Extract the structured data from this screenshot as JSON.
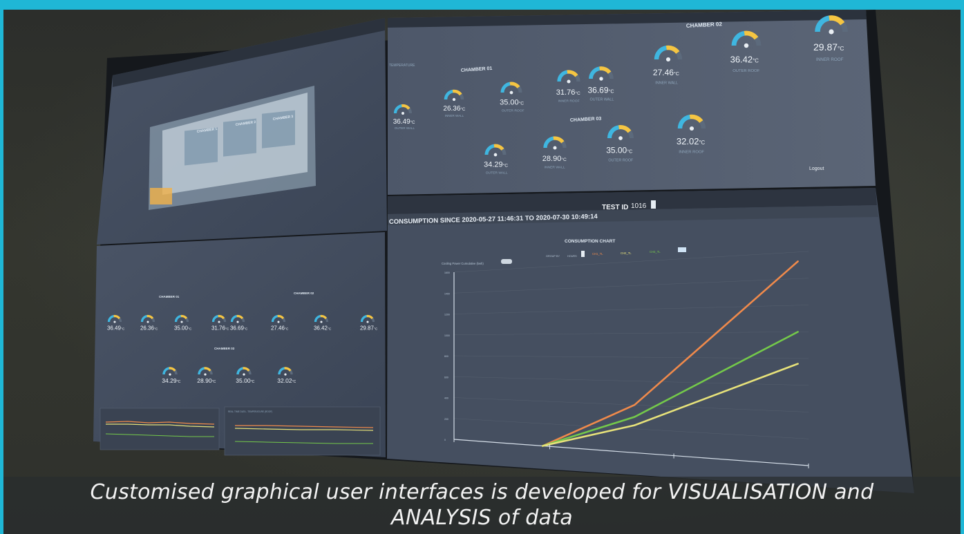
{
  "screens": {
    "top_left": {
      "chambers": [
        "CHAMBER 1",
        "CHAMBER 2",
        "CHAMBER 3"
      ]
    },
    "top_right": {
      "section_label": "TEMPERATURE",
      "chamber_01": {
        "title": "CHAMBER 01",
        "gauges": [
          {
            "value": "36.49",
            "unit": "°C",
            "label": "OUTER WALL"
          },
          {
            "value": "26.36",
            "unit": "°C",
            "label": "INNER WALL"
          },
          {
            "value": "35.00",
            "unit": "°C",
            "label": "OUTER ROOF"
          },
          {
            "value": "31.76",
            "unit": "°C",
            "label": "INNER ROOF"
          }
        ]
      },
      "chamber_02": {
        "title": "CHAMBER 02",
        "gauges": [
          {
            "value": "36.69",
            "unit": "°C",
            "label": "OUTER WALL"
          },
          {
            "value": "27.46",
            "unit": "°C",
            "label": "INNER WALL"
          },
          {
            "value": "36.42",
            "unit": "°C",
            "label": "OUTER ROOF"
          },
          {
            "value": "29.87",
            "unit": "°C",
            "label": "INNER ROOF"
          }
        ]
      },
      "chamber_03": {
        "title": "CHAMBER 03",
        "gauges": [
          {
            "value": "34.29",
            "unit": "°C",
            "label": "OUTER WALL"
          },
          {
            "value": "28.90",
            "unit": "°C",
            "label": "INNER WALL"
          },
          {
            "value": "35.00",
            "unit": "°C",
            "label": "OUTER ROOF"
          },
          {
            "value": "32.02",
            "unit": "°C",
            "label": "INNER ROOF"
          }
        ]
      },
      "logout_label": "Logout"
    },
    "bottom_left": {
      "chamber_01_title": "CHAMBER 01",
      "chamber_02_title": "CHAMBER 02",
      "chamber_03_title": "CHAMBER 03",
      "row1": [
        {
          "value": "36.49",
          "unit": "°C"
        },
        {
          "value": "26.36",
          "unit": "°C"
        },
        {
          "value": "35.00",
          "unit": "°C"
        },
        {
          "value": "31.76",
          "unit": "°C"
        },
        {
          "value": "36.69",
          "unit": "°C"
        },
        {
          "value": "27.46",
          "unit": "°C"
        },
        {
          "value": "36.42",
          "unit": "°C"
        },
        {
          "value": "29.87",
          "unit": "°C"
        }
      ],
      "row2": [
        {
          "value": "34.29",
          "unit": "°C"
        },
        {
          "value": "28.90",
          "unit": "°C"
        },
        {
          "value": "35.00",
          "unit": "°C"
        },
        {
          "value": "32.02",
          "unit": "°C"
        }
      ],
      "mini_chart_right_title": "REAL TIME DATA - TEMPERATURE (ROOF)"
    },
    "bottom_right": {
      "header_text": "CONSUMPTION SINCE 2020-05-27 11:46:31 TO 2020-07-30 10:49:14",
      "test_id_label": "TEST ID",
      "test_id_value": "1016",
      "chart_title": "CONSUMPTION CHART",
      "cooling_label": "Cooling Power Cumulative (kwh)",
      "group_by_label": "GROUP BY",
      "group_by_value": "HOURS",
      "legend": [
        "CH1_TL",
        "CH2_TL",
        "CH3_TL"
      ]
    }
  },
  "chart_data": {
    "type": "line",
    "title": "CONSUMPTION CHART",
    "ylim": [
      0,
      1600
    ],
    "yticks": [
      0,
      200,
      400,
      600,
      800,
      1000,
      1200,
      1400,
      1600
    ],
    "series": [
      {
        "name": "CH1_TL",
        "color": "#f08a4b",
        "x": [
          0,
          0.36,
          1.0
        ],
        "y": [
          0,
          400,
          1530
        ]
      },
      {
        "name": "CH2_TL",
        "color": "#74c94a",
        "x": [
          0,
          0.36,
          1.0
        ],
        "y": [
          0,
          300,
          1000
        ]
      },
      {
        "name": "CH3_TL",
        "color": "#e7e27a",
        "x": [
          0,
          0.36,
          1.0
        ],
        "y": [
          0,
          230,
          760
        ]
      }
    ],
    "grid": true
  },
  "caption": {
    "line1": "Customised graphical user interfaces is developed for VISUALISATION and",
    "line2": "ANALYSIS of data"
  },
  "colors": {
    "screen_bg": "#3d4758",
    "frame": "#1fb7d6",
    "gauge_track": "#5c6a7c",
    "gauge_warm": "#f5c542",
    "gauge_cool": "#3fb6e0"
  }
}
